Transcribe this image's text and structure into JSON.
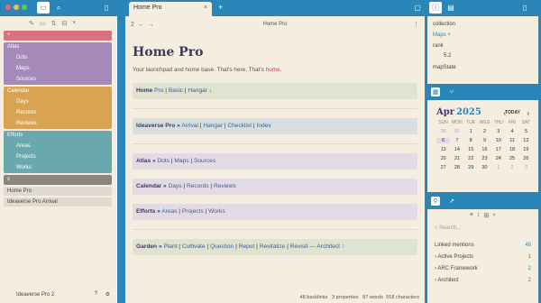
{
  "tab": {
    "title": "Home Pro",
    "close": "×",
    "new": "+"
  },
  "nav": {
    "back": "←",
    "forward": "→",
    "count": "2",
    "breadcrumb": "Home Pro"
  },
  "sidebar": {
    "folders": [
      {
        "label": "+",
        "color": "#d9717f",
        "items": []
      },
      {
        "label": "Atlas",
        "color": "#a589b8",
        "items": [
          "Dots",
          "Maps",
          "Sources"
        ]
      },
      {
        "label": "Calendar",
        "color": "#d8a453",
        "items": [
          "Days",
          "Records",
          "Reviews"
        ]
      },
      {
        "label": "Efforts",
        "color": "#6aa8b0",
        "items": [
          "Areas",
          "Projects",
          "Works"
        ]
      },
      {
        "label": "x",
        "color": "#8a8580",
        "items": []
      }
    ],
    "files": [
      "Home Pro",
      "Ideaverse Pro Arrival"
    ],
    "vault": "Ideaverse Pro 2"
  },
  "note": {
    "title": "Home Pro",
    "intro_a": "Your launchpad and home base. That's here. That's ",
    "intro_b": "home.",
    "callouts": [
      {
        "lead": "Home",
        "links": [
          "Pro",
          "Basic",
          "Hangar ↓"
        ],
        "tone": "c-green"
      },
      {
        "lead": "Ideaverse Pro »",
        "links": [
          "Arrival",
          "Hangar",
          "Checklist",
          "Index"
        ],
        "tone": "c-blue"
      },
      {
        "lead": "Atlas »",
        "links": [
          "Dots",
          "Maps",
          "Sources"
        ],
        "tone": "c-purple"
      },
      {
        "lead": "Calendar »",
        "links": [
          "Days",
          "Records",
          "Reviews"
        ],
        "tone": "c-purple"
      },
      {
        "lead": "Efforts »",
        "links": [
          "Areas",
          "Projects",
          "Works"
        ],
        "tone": "c-purple"
      },
      {
        "lead": "Garden »",
        "links": [
          "Plant",
          "Cultivate",
          "Question",
          "Repot",
          "Revitalize",
          "Revisit — Architect ↑"
        ],
        "tone": "c-green"
      }
    ]
  },
  "status": {
    "backlinks": "48 backlinks",
    "properties": "3 properties",
    "words": "87 words",
    "chars": "918 characters"
  },
  "properties": {
    "collection_key": "collection",
    "collection_value": "Maps",
    "rank_key": "rank",
    "rank_value": "5.2",
    "mapstate_key": "mapState"
  },
  "calendar": {
    "month": "Apr",
    "year": "2025",
    "today": "TODAY",
    "prev": "‹",
    "next": "›",
    "dow": [
      "SUN",
      "MON",
      "TUE",
      "WED",
      "THU",
      "FRI",
      "SAT"
    ],
    "days": [
      "30",
      "31",
      "1",
      "2",
      "3",
      "4",
      "5",
      "6",
      "7",
      "8",
      "9",
      "10",
      "11",
      "12",
      "13",
      "14",
      "15",
      "16",
      "17",
      "18",
      "19",
      "20",
      "21",
      "22",
      "23",
      "24",
      "25",
      "26",
      "27",
      "28",
      "29",
      "30",
      "1",
      "2",
      "3"
    ]
  },
  "mentions": {
    "search_placeholder": "Search...",
    "header": "Linked mentions",
    "count": "48",
    "items": [
      {
        "label": "Active Projects",
        "count": "1"
      },
      {
        "label": "ARC Framework",
        "count": "2"
      },
      {
        "label": "Architect",
        "count": "2"
      }
    ]
  }
}
